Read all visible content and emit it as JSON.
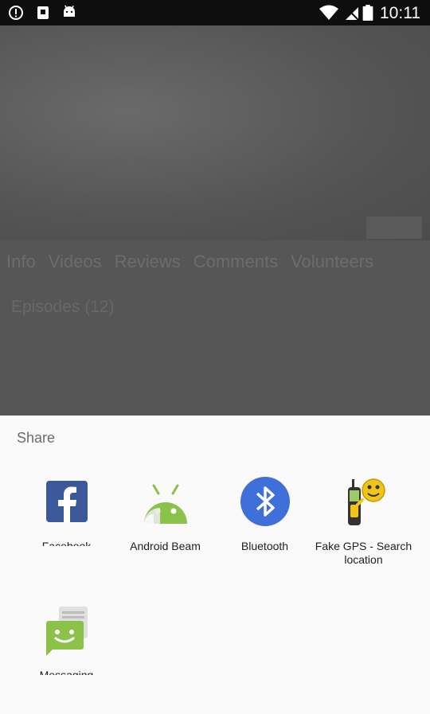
{
  "status_bar": {
    "time": "10:11",
    "left_icons": [
      "alert-circle-icon",
      "lock-icon",
      "android-icon"
    ],
    "right_icons": [
      "wifi-icon",
      "no-sim-icon",
      "signal-icon",
      "battery-icon"
    ]
  },
  "background_app": {
    "tabs": [
      "Info",
      "Videos",
      "Reviews",
      "Comments",
      "Volunteers"
    ],
    "episodes_label": "Episodes (12)"
  },
  "share_sheet": {
    "title": "Share",
    "apps": [
      {
        "label": "Facebook",
        "icon": "facebook-icon",
        "color": "#3b5998"
      },
      {
        "label": "Android Beam",
        "icon": "android-beam-icon",
        "color": "#8bc34a"
      },
      {
        "label": "Bluetooth",
        "icon": "bluetooth-icon",
        "color": "#3f6fd8"
      },
      {
        "label": "Fake GPS - Search location",
        "icon": "gps-device-icon",
        "color": "#f0c419"
      },
      {
        "label": "Messaging",
        "icon": "messaging-icon",
        "color": "#8bc34a"
      }
    ]
  }
}
